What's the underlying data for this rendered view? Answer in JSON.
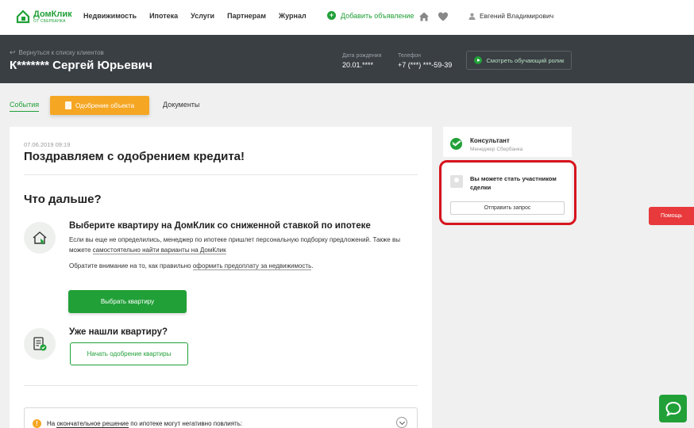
{
  "logo": {
    "name": "ДомКлик",
    "sub": "ОТ СБЕРБАНКА"
  },
  "nav": {
    "items": [
      "Недвижимость",
      "Ипотека",
      "Услуги",
      "Партнерам",
      "Журнал"
    ]
  },
  "add_listing": "Добавить объявление",
  "user": {
    "name": "Евгений Владимирович"
  },
  "client": {
    "back_link": "Вернуться к списку клиентов",
    "name": "К******* Сергей Юрьевич",
    "birth_label": "Дата рождения",
    "birth_value": "20.01.****",
    "phone_label": "Телефон",
    "phone_value": "+7 (***) ***-59-39",
    "video_button": "Смотреть обучающий ролик"
  },
  "tabs": {
    "events": "События",
    "approval": "Одобрение объекта",
    "documents": "Документы"
  },
  "main": {
    "date": "07.06.2019  09:19",
    "congrats": "Поздравляем с одобрением кредита!",
    "whats_next": "Что дальше?",
    "step1_title": "Выберите квартиру на ДомКлик со сниженной ставкой по ипотеке",
    "step1_text_a": "Если вы еще не определились, менеджер по ипотеке пришлет персональную подборку предложений. Также вы можете ",
    "step1_link": "самостоятельно найти варианты на ДомКлик",
    "step1_note_a": "Обратите внимание на то, как правильно ",
    "step1_note_link": "оформить предоплату за недвижимость",
    "step1_note_b": ".",
    "choose_button": "Выбрать квартиру",
    "step2_title": "Уже нашли квартиру?",
    "start_button": "Начать одобрение квартиры",
    "warning_a": "На ",
    "warning_u1": "окончательное решение",
    "warning_b": " по ипотеке могут негативно повлиять:"
  },
  "consultant": {
    "title": "Консультант",
    "subtitle": "Менеджер Сбербанка"
  },
  "participant": {
    "text": "Вы можете стать участником сделки",
    "button": "Отправить запрос"
  },
  "help": "Помощь",
  "colors": {
    "brand_green": "#21a038",
    "accent_orange": "#f5a623",
    "highlight_red": "#d7141d",
    "help_red": "#e8393c",
    "header_dark": "#3a3f44"
  }
}
